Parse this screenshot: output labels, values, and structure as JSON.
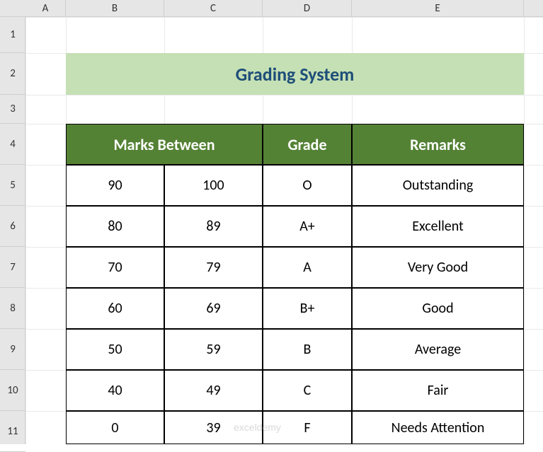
{
  "columns": [
    "A",
    "B",
    "C",
    "D",
    "E"
  ],
  "rows": [
    "1",
    "2",
    "3",
    "4",
    "5",
    "6",
    "7",
    "8",
    "9",
    "10",
    "11"
  ],
  "title": "Grading System",
  "headers": {
    "marks": "Marks Between",
    "grade": "Grade",
    "remarks": "Remarks"
  },
  "data": [
    {
      "lo": "90",
      "hi": "100",
      "grade": "O",
      "remarks": "Outstanding"
    },
    {
      "lo": "80",
      "hi": "89",
      "grade": "A+",
      "remarks": "Excellent"
    },
    {
      "lo": "70",
      "hi": "79",
      "grade": "A",
      "remarks": "Very Good"
    },
    {
      "lo": "60",
      "hi": "69",
      "grade": "B+",
      "remarks": "Good"
    },
    {
      "lo": "50",
      "hi": "59",
      "grade": "B",
      "remarks": "Average"
    },
    {
      "lo": "40",
      "hi": "49",
      "grade": "C",
      "remarks": "Fair"
    },
    {
      "lo": "0",
      "hi": "39",
      "grade": "F",
      "remarks": "Needs Attention"
    }
  ],
  "watermark": "exceldemy"
}
